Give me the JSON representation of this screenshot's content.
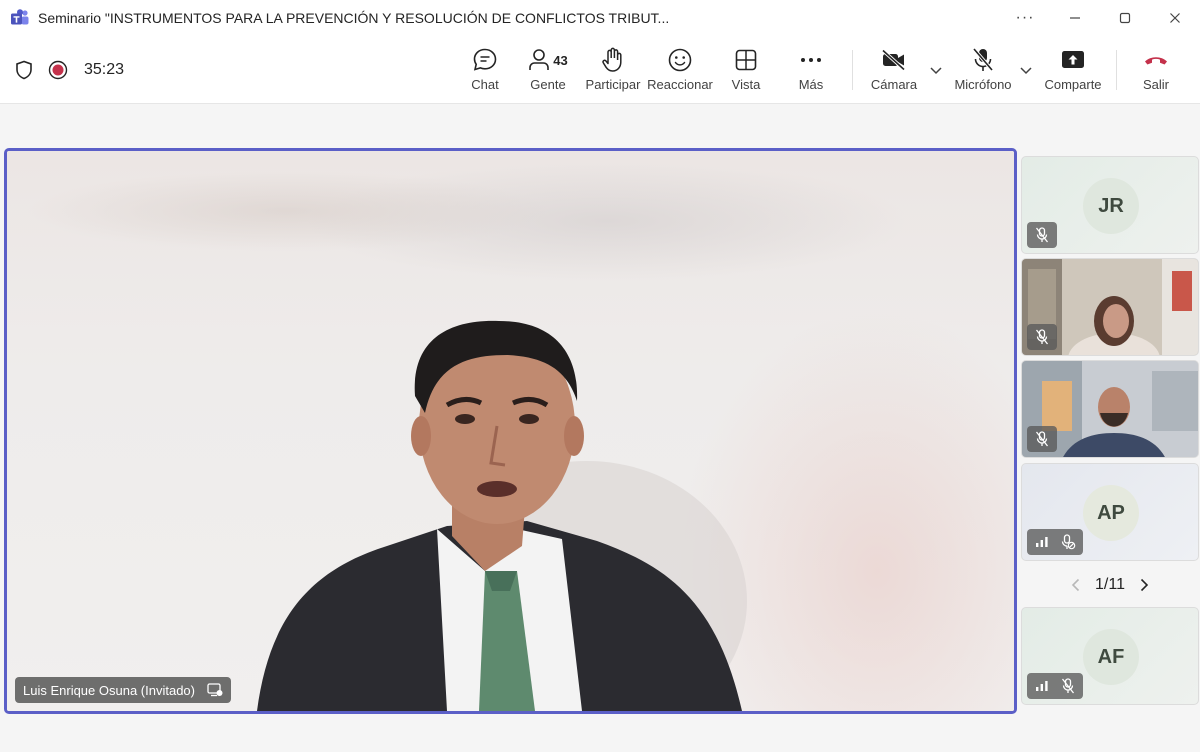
{
  "window": {
    "title": "Seminario \"INSTRUMENTOS PARA LA PREVENCIÓN Y RESOLUCIÓN DE CONFLICTOS TRIBUT...",
    "more": "···"
  },
  "meeting": {
    "timer": "35:23",
    "people_count": "43"
  },
  "toolbar": {
    "chat": "Chat",
    "people": "Gente",
    "raise": "Participar",
    "react": "Reaccionar",
    "view": "Vista",
    "more": "Más",
    "camera": "Cámara",
    "mic": "Micrófono",
    "share": "Comparte",
    "leave": "Salir"
  },
  "stage": {
    "speaker_name": "Luis Enrique Osuna (Invitado)"
  },
  "participants": [
    {
      "initials": "JR",
      "video": false,
      "muted": true
    },
    {
      "initials": "",
      "video": true,
      "muted": true
    },
    {
      "initials": "",
      "video": true,
      "muted": true
    },
    {
      "initials": "AP",
      "video": false,
      "muted": true
    },
    {
      "initials": "AF",
      "video": false,
      "muted": true
    }
  ],
  "pager": {
    "label": "1/11"
  },
  "colors": {
    "accent": "#5b5fc7",
    "recording": "#c4314b",
    "leave": "#c4314b"
  }
}
